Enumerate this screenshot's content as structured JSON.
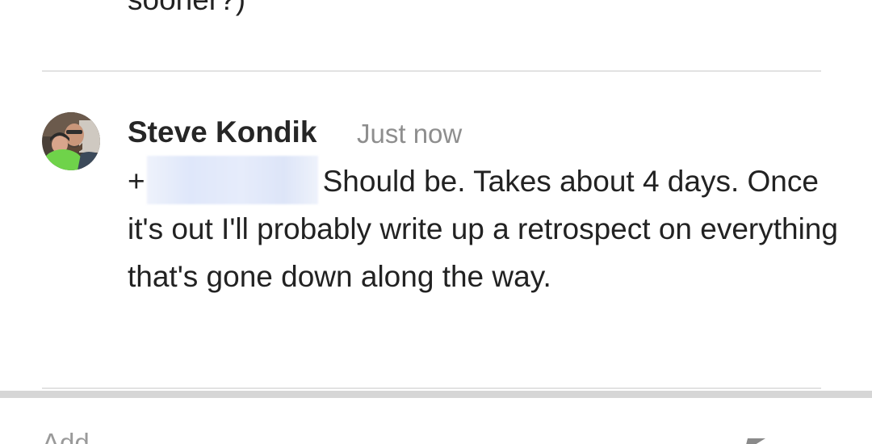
{
  "previous_comment": {
    "text_tail": "sooner?)"
  },
  "comment": {
    "author": "Steve Kondik",
    "timestamp": "Just now",
    "mention_prefix": "+",
    "text": "Should be. Takes about 4 days. Once it's out I'll probably write up a retrospect on everything that's gone down along the way.",
    "avatar_icon": "user-avatar-photo"
  },
  "compose": {
    "placeholder_partial": "Add",
    "send_icon": "send-icon"
  },
  "colors": {
    "divider": "#e2e2e2",
    "timestamp": "#8e8e8e",
    "text": "#222222",
    "mention_redaction": "#dfe7fa",
    "footer_shadow": "#d6d6d6"
  }
}
